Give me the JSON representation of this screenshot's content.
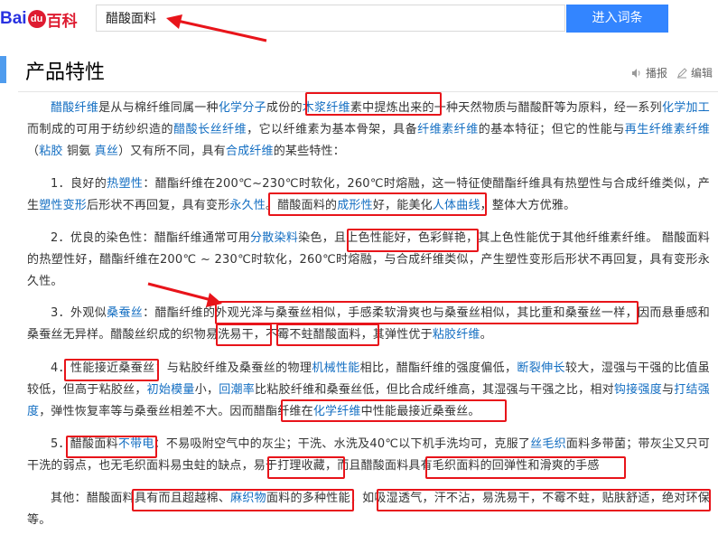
{
  "header": {
    "logo_bai": "Bai",
    "logo_paw": "du",
    "logo_baike": "百科",
    "search_value": "醋酸面料",
    "search_button": "进入词条"
  },
  "section": {
    "title": "产品特性",
    "tools": [
      {
        "label": "播报",
        "icon": "speaker-icon"
      },
      {
        "label": "编辑",
        "icon": "edit-icon"
      }
    ]
  },
  "colors": {
    "link": "#136ec2",
    "annotation": "#e8141a",
    "button": "#3385ff",
    "title_accent": "#4f9cee",
    "text": "#333333"
  },
  "paragraphs": [
    {
      "id": "intro",
      "runs": [
        {
          "t": "醋酸纤维",
          "link": true
        },
        {
          "t": "是从与棉纤维同属一种"
        },
        {
          "t": "化学分子",
          "link": true
        },
        {
          "t": "成份的"
        },
        {
          "t": "木浆纤维",
          "link": true
        },
        {
          "t": "素中提炼出来的一种天然物质与醋酸酐等为原料，经一系列"
        },
        {
          "t": "化学加工",
          "link": true
        },
        {
          "t": "而制成的可用于纺纱织造的"
        },
        {
          "t": "醋酸长丝纤维",
          "link": true
        },
        {
          "t": "，它以纤维素为基本骨架，具备"
        },
        {
          "t": "纤维素纤维",
          "link": true
        },
        {
          "t": "的基本特征；但它的性能与"
        },
        {
          "t": "再生纤维素纤维",
          "link": true
        },
        {
          "t": "（"
        },
        {
          "t": "粘胶",
          "link": true
        },
        {
          "t": " 铜氨 "
        },
        {
          "t": "真丝",
          "link": true
        },
        {
          "t": "）又有所不同，具有"
        },
        {
          "t": "合成纤维",
          "link": true
        },
        {
          "t": "的某些特性："
        }
      ]
    },
    {
      "id": "p1",
      "runs": [
        {
          "t": "1．良好的"
        },
        {
          "t": "热塑性",
          "link": true
        },
        {
          "t": "：醋酯纤维在200℃~230℃时软化，260℃时熔融，这一特征使醋酯纤维具有热塑性与合成纤维类似，产生"
        },
        {
          "t": "塑性变形",
          "link": true
        },
        {
          "t": "后形状不再回复，具有变形"
        },
        {
          "t": "永久性",
          "link": true
        },
        {
          "t": "。醋酸面料的"
        },
        {
          "t": "成形性",
          "link": true
        },
        {
          "t": "好，能美化"
        },
        {
          "t": "人体曲线",
          "link": true
        },
        {
          "t": "，整体大方优雅。"
        }
      ]
    },
    {
      "id": "p2",
      "runs": [
        {
          "t": "2．优良的染色性：醋酯纤维通常可用"
        },
        {
          "t": "分散染料",
          "link": true
        },
        {
          "t": "染色，且上色性能好，色彩鲜艳，其上色性能优于其他纤维素纤维。 醋酸面料的热塑性好，醋酯纤维在200℃ ~ 230℃时软化，260℃时熔融，与合成纤维类似，产生塑性变形后形状不再回复，具有变形永久性。"
        }
      ]
    },
    {
      "id": "p3",
      "runs": [
        {
          "t": "3．外观似"
        },
        {
          "t": "桑蚕丝",
          "link": true
        },
        {
          "t": "：醋酯纤维的外观光泽与桑蚕丝相似，手感柔软滑爽也与桑蚕丝相似，其比重和桑蚕丝一样，因而悬垂感和桑蚕丝无异样。醋酸丝织成的织物易洗易干，不霉不蛀醋酸面料，其弹性优于"
        },
        {
          "t": "粘胶纤维",
          "link": true
        },
        {
          "t": "。"
        }
      ]
    },
    {
      "id": "p4",
      "runs": [
        {
          "t": "4．性能接近桑蚕丝：与粘胶纤维及桑蚕丝的物理"
        },
        {
          "t": "机械性能",
          "link": true
        },
        {
          "t": "相比，醋酯纤维的强度偏低，"
        },
        {
          "t": "断裂伸长",
          "link": true
        },
        {
          "t": "较大，湿强与干强的比值虽较低，但高于粘胶丝，"
        },
        {
          "t": "初始模量",
          "link": true
        },
        {
          "t": "小，"
        },
        {
          "t": "回潮率",
          "link": true
        },
        {
          "t": "比粘胶纤维和桑蚕丝低，但比合成纤维高，其湿强与干强之比，相对"
        },
        {
          "t": "钩接强度",
          "link": true
        },
        {
          "t": "与"
        },
        {
          "t": "打结强度",
          "link": true
        },
        {
          "t": "，弹性恢复率等与桑蚕丝相差不大。因而醋酯纤维在"
        },
        {
          "t": "化学纤维",
          "link": true
        },
        {
          "t": "中性能最接近桑蚕丝。"
        }
      ]
    },
    {
      "id": "p5",
      "runs": [
        {
          "t": "5．醋酸面料"
        },
        {
          "t": "不带电",
          "link": true
        },
        {
          "t": "：不易吸附空气中的灰尘；干洗、水洗及40℃以下机手洗均可，克服了"
        },
        {
          "t": "丝毛织",
          "link": true
        },
        {
          "t": "面料多带菌；带灰尘又只可干洗的弱点，也无毛织面料易虫蛀的缺点，易于打理收藏，而且醋酸面料具有毛织面料的回弹性和滑爽的手感"
        }
      ]
    },
    {
      "id": "other",
      "runs": [
        {
          "t": "其他：醋酸面料具有而且超越棉、"
        },
        {
          "t": "麻织物",
          "link": true
        },
        {
          "t": "面料的多种性能，如吸湿透气，汗不沾，易洗易干，不霉不蛀，贴肤舒适，绝对环保等。"
        }
      ]
    }
  ]
}
